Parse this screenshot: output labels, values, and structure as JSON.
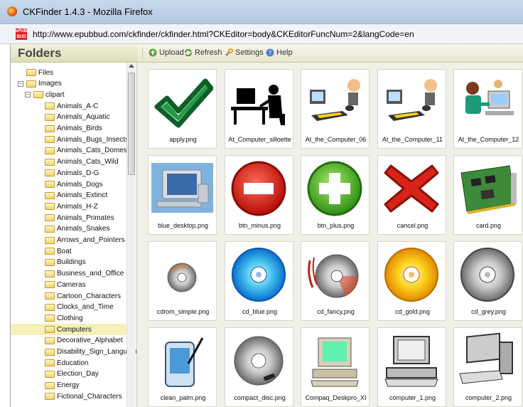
{
  "window": {
    "title": "CKFinder 1.4.3 - Mozilla Firefox"
  },
  "browser": {
    "url": "http://www.epubbud.com/ckfinder/ckfinder.html?CKEditor=body&CKEditorFuncNum=2&langCode=en",
    "favicon_text": "ePUB BUD"
  },
  "sidebar": {
    "title": "Folders"
  },
  "toolbar": {
    "upload": "Upload",
    "refresh": "Refresh",
    "settings": "Settings",
    "help": "Help"
  },
  "tree": [
    {
      "label": "Files"
    },
    {
      "label": "Images"
    },
    {
      "label": "clipart"
    },
    {
      "label": "Animals_A-C"
    },
    {
      "label": "Animals_Aquatic"
    },
    {
      "label": "Animals_Birds"
    },
    {
      "label": "Animals_Bugs_Insects"
    },
    {
      "label": "Animals_Cats_Domestic"
    },
    {
      "label": "Animals_Cats_Wild"
    },
    {
      "label": "Animals_D-G"
    },
    {
      "label": "Animals_Dogs"
    },
    {
      "label": "Animals_Extinct"
    },
    {
      "label": "Animals_H-Z"
    },
    {
      "label": "Animals_Primates"
    },
    {
      "label": "Animals_Snakes"
    },
    {
      "label": "Arrows_and_Pointers"
    },
    {
      "label": "Boat"
    },
    {
      "label": "Buildings"
    },
    {
      "label": "Business_and_Office"
    },
    {
      "label": "Cameras"
    },
    {
      "label": "Cartoon_Characters"
    },
    {
      "label": "Clocks_and_Time"
    },
    {
      "label": "Clothing"
    },
    {
      "label": "Computers",
      "selected": true
    },
    {
      "label": "Decorative_Alphabet"
    },
    {
      "label": "Disability_Sign_Language"
    },
    {
      "label": "Education"
    },
    {
      "label": "Election_Day"
    },
    {
      "label": "Energy"
    },
    {
      "label": "Fictional_Characters"
    }
  ],
  "files": [
    {
      "name": "apply.png",
      "icon": "check-icon"
    },
    {
      "name": "At_Computer_silloette",
      "icon": "computer-silhouette-icon"
    },
    {
      "name": "At_the_Computer_06",
      "icon": "person-at-computer-icon"
    },
    {
      "name": "At_the_Computer_11",
      "icon": "person-at-computer-icon"
    },
    {
      "name": "At_the_Computer_12",
      "icon": "people-at-computer-icon"
    },
    {
      "name": "blue_desktop.png",
      "icon": "desktop-computer-icon"
    },
    {
      "name": "btn_minus.png",
      "icon": "minus-button-icon"
    },
    {
      "name": "btn_plus.png",
      "icon": "plus-button-icon"
    },
    {
      "name": "cancel.png",
      "icon": "cancel-x-icon"
    },
    {
      "name": "card.png",
      "icon": "circuit-card-icon"
    },
    {
      "name": "cdrom_simple.png",
      "icon": "cd-icon"
    },
    {
      "name": "cd_blue.png",
      "icon": "cd-icon"
    },
    {
      "name": "cd_fancy.png",
      "icon": "cd-icon"
    },
    {
      "name": "cd_gold.png",
      "icon": "cd-icon"
    },
    {
      "name": "cd_grey.png",
      "icon": "cd-icon"
    },
    {
      "name": "clean_palm.png",
      "icon": "pda-icon"
    },
    {
      "name": "compact_disc.png",
      "icon": "cd-icon"
    },
    {
      "name": "Compaq_Deskpro_XI",
      "icon": "desktop-computer-icon"
    },
    {
      "name": "computer_1.png",
      "icon": "computer-icon"
    },
    {
      "name": "computer_2.png",
      "icon": "computer-icon"
    }
  ]
}
